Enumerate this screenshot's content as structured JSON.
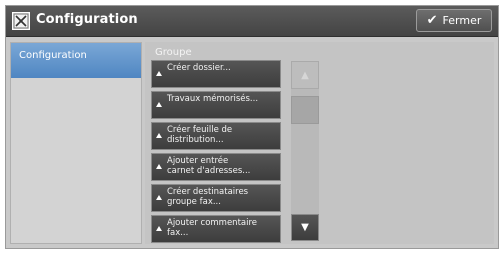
{
  "header": {
    "icon": "tools-grid-icon",
    "title": "Configuration",
    "close_label": "Fermer"
  },
  "sidebar": {
    "items": [
      {
        "label": "Configuration",
        "selected": true
      }
    ]
  },
  "main": {
    "group_label": "Groupe",
    "items": [
      {
        "line1": "Créer dossier...",
        "line2": ""
      },
      {
        "line1": "Travaux mémorisés...",
        "line2": ""
      },
      {
        "line1": "Créer feuille de",
        "line2": "distribution..."
      },
      {
        "line1": "Ajouter entrée",
        "line2": "carnet d'adresses..."
      },
      {
        "line1": "Créer destinataires",
        "line2": "groupe fax..."
      },
      {
        "line1": "Ajouter commentaire",
        "line2": "fax..."
      }
    ]
  },
  "scrollbar": {
    "up_icon": "up-arrow-icon",
    "down_icon": "down-arrow-icon"
  }
}
